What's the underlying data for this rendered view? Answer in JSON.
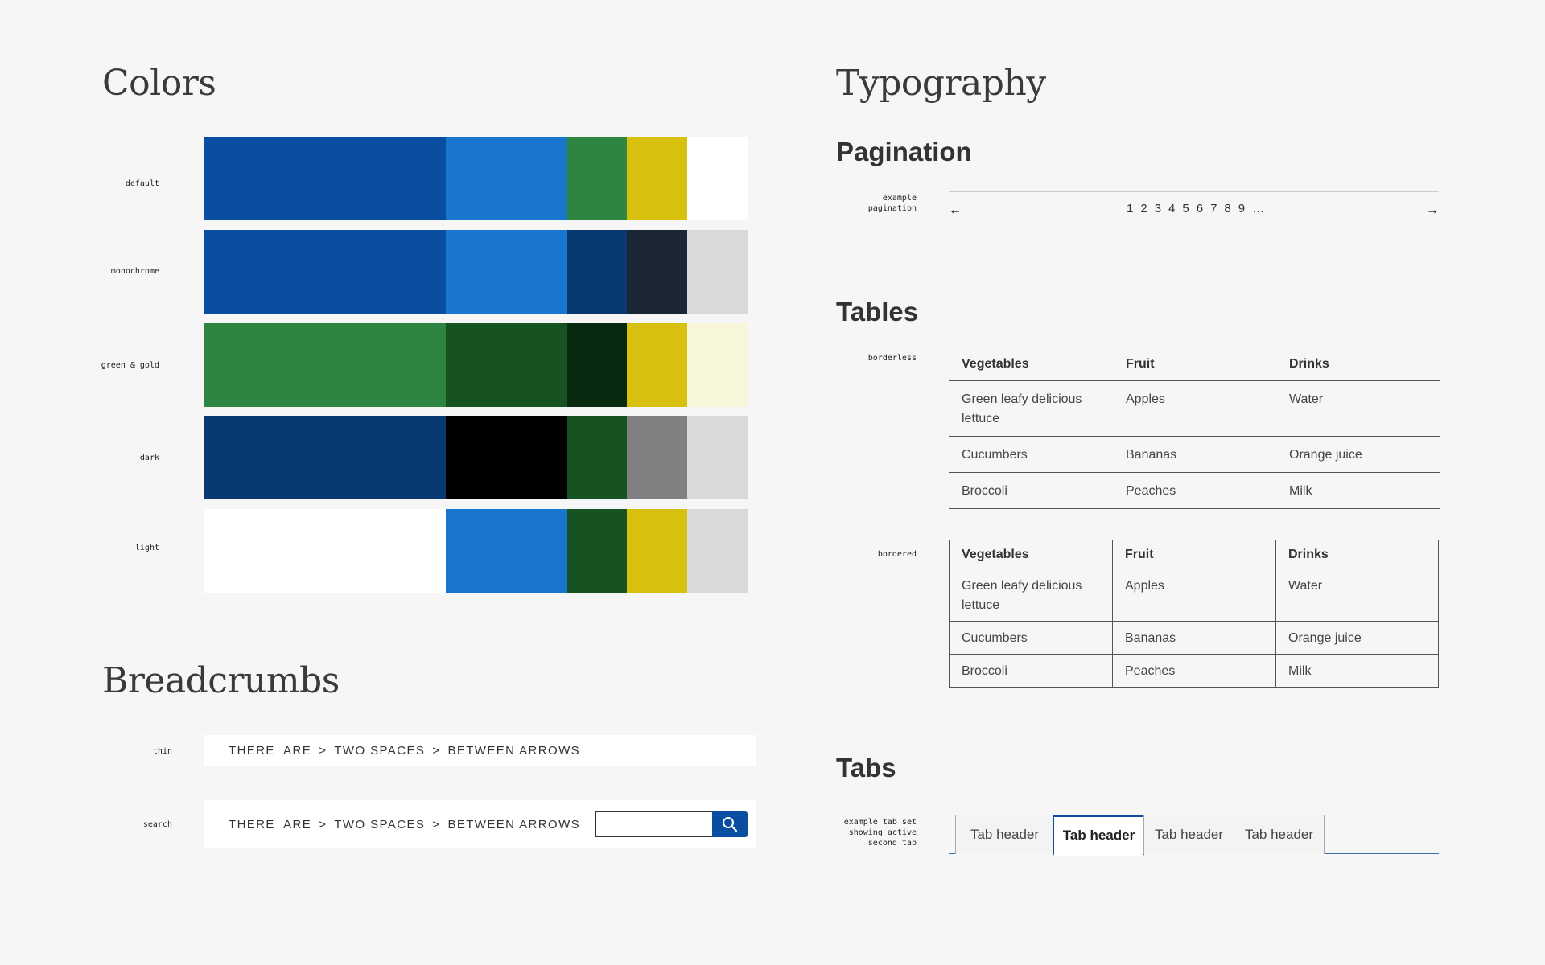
{
  "colors": {
    "title": "Colors",
    "rows": [
      {
        "label": "default",
        "swatches": [
          "#0a4ea1",
          "#1976cf",
          "#2e8541",
          "#d8c00e",
          "#ffffff"
        ]
      },
      {
        "label": "monochrome",
        "swatches": [
          "#0a4ea1",
          "#1976cf",
          "#083970",
          "#1c2735",
          "#d9d9d9"
        ]
      },
      {
        "label": "green & gold",
        "swatches": [
          "#2e8541",
          "#175223",
          "#0a2911",
          "#d8c00e",
          "#f7f6db"
        ]
      },
      {
        "label": "dark",
        "swatches": [
          "#083970",
          "#000000",
          "#175223",
          "#808080",
          "#d9d9d9"
        ]
      },
      {
        "label": "light",
        "swatches": [
          "#ffffff",
          "#1976cf",
          "#175223",
          "#d8c00e",
          "#d9d9d9"
        ]
      }
    ]
  },
  "breadcrumbs": {
    "title": "Breadcrumbs",
    "thin": {
      "label": "thin",
      "items": [
        "THERE  ARE",
        "TWO SPACES",
        "BETWEEN ARROWS"
      ],
      "separator": ">"
    },
    "search": {
      "label": "search",
      "items": [
        "THERE  ARE",
        "TWO SPACES",
        "BETWEEN ARROWS"
      ],
      "separator": ">",
      "input_value": ""
    }
  },
  "typography": {
    "title": "Typography"
  },
  "pagination": {
    "title": "Pagination",
    "label_line1": "example",
    "label_line2": "pagination",
    "prev": "←",
    "next": "→",
    "pages": [
      "1",
      "2",
      "3",
      "4",
      "5",
      "6",
      "7",
      "8",
      "9",
      "…"
    ]
  },
  "tables": {
    "title": "Tables",
    "borderless_label": "borderless",
    "bordered_label": "bordered",
    "headers": [
      "Vegetables",
      "Fruit",
      "Drinks"
    ],
    "rows": [
      [
        "Green leafy delicious lettuce",
        "Apples",
        "Water"
      ],
      [
        "Cucumbers",
        "Bananas",
        "Orange juice"
      ],
      [
        "Broccoli",
        "Peaches",
        "Milk"
      ]
    ]
  },
  "tabs": {
    "title": "Tabs",
    "label_line1": "example tab set",
    "label_line2": "showing active",
    "label_line3": "second tab",
    "items": [
      "Tab header",
      "Tab header",
      "Tab header",
      "Tab header"
    ],
    "active_index": 1
  }
}
